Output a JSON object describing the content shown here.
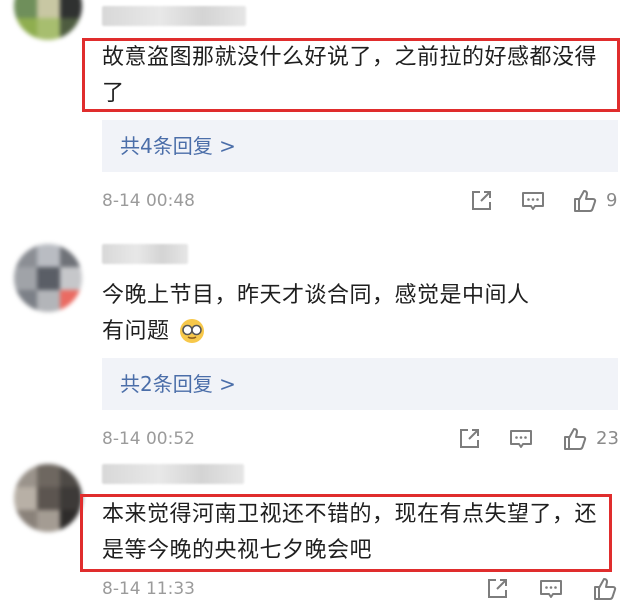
{
  "comments": [
    {
      "text": "故意盗图那就没什么好说了，之前拉的好感都没得了",
      "replies": "共4条回复 >",
      "time": "8-14 00:48",
      "likes": "9"
    },
    {
      "text": "今晚上节目，昨天才谈合同，感觉是中间人有问题",
      "emoji": "glasses-emoji",
      "replies": "共2条回复 >",
      "time": "8-14 00:52",
      "likes": "23"
    },
    {
      "text": "本来觉得河南卫视还不错的，现在有点失望了，还是等今晚的央视七夕晚会吧",
      "time": "8-14 11:33"
    }
  ],
  "icons": [
    "share-icon",
    "comment-icon",
    "like-icon"
  ],
  "colors": {
    "highlight": "#e02d2d",
    "reply_link": "#4b6ea9",
    "reply_bg": "#f1f3f8"
  }
}
